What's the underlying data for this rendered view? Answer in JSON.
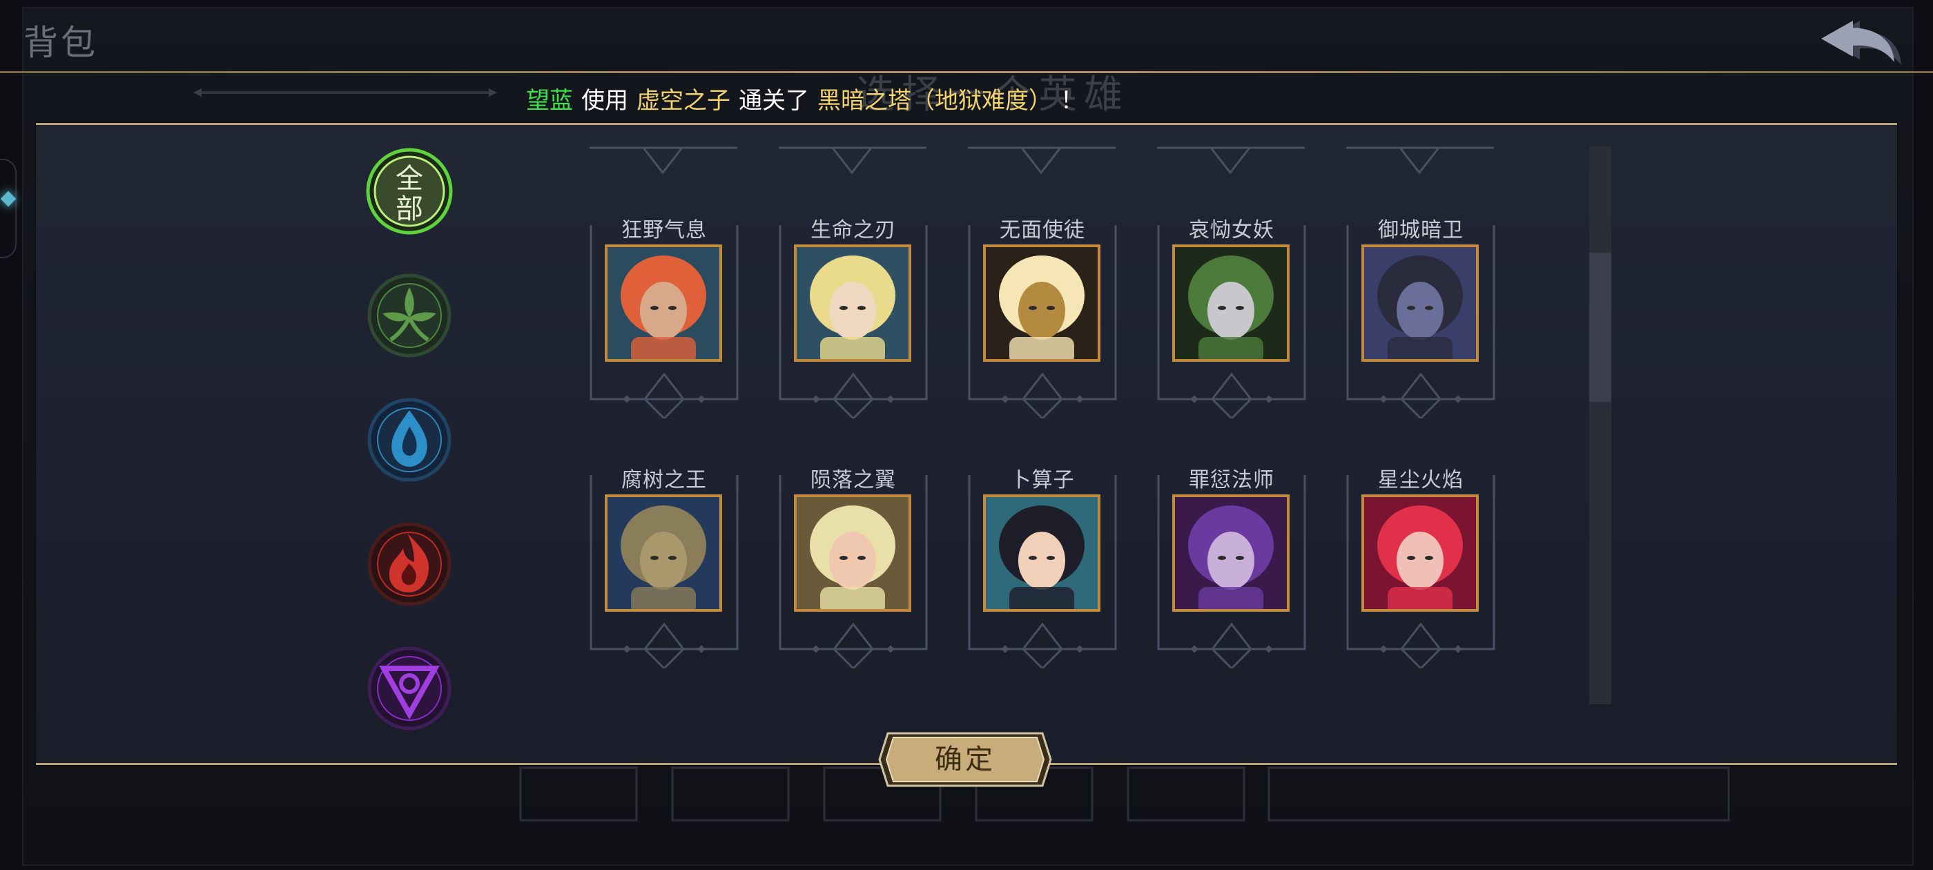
{
  "window": {
    "title": "背包"
  },
  "behind_title": "选择一个英雄",
  "broadcast": {
    "player": "望蓝",
    "verb_use": "使用",
    "hero": "虚空之子",
    "verb_clear": "通关了",
    "stage": "黑暗之塔（地狱难度）",
    "end": "！"
  },
  "filters": [
    {
      "id": "all",
      "label": "全部",
      "icon": "all-faction-icon",
      "selected": true,
      "color": "#5fd33b"
    },
    {
      "id": "nature",
      "label": "",
      "icon": "leaf-faction-icon",
      "selected": false,
      "color": "#4b8a3e"
    },
    {
      "id": "water",
      "label": "",
      "icon": "water-faction-icon",
      "selected": false,
      "color": "#2e86b8"
    },
    {
      "id": "fire",
      "label": "",
      "icon": "fire-faction-icon",
      "selected": false,
      "color": "#c22a23"
    },
    {
      "id": "void",
      "label": "",
      "icon": "void-faction-icon",
      "selected": false,
      "color": "#8b2bc9"
    }
  ],
  "heroes": [
    {
      "name": "狂野气息",
      "portrait": "red-haired-warrior-portrait",
      "bg": "#2b4b5f",
      "hair": "#e0603a",
      "skin": "#d8a88a"
    },
    {
      "name": "生命之刃",
      "portrait": "blonde-elf-portrait",
      "bg": "#2f4f63",
      "hair": "#eadb8c",
      "skin": "#f0d8c0"
    },
    {
      "name": "无面使徒",
      "portrait": "faceless-lantern-portrait",
      "bg": "#2a2118",
      "hair": "#f6e6b6",
      "skin": "#b48a40"
    },
    {
      "name": "哀恸女妖",
      "portrait": "banshee-portrait",
      "bg": "#1d2a1a",
      "hair": "#4c7a3a",
      "skin": "#c8c8cc"
    },
    {
      "name": "御城暗卫",
      "portrait": "dark-guard-portrait",
      "bg": "#3a3f6a",
      "hair": "#2a2c3e",
      "skin": "#6a6f9a"
    },
    {
      "name": "腐树之王",
      "portrait": "tree-king-portrait",
      "bg": "#243a5c",
      "hair": "#8a7d5a",
      "skin": "#a8986c"
    },
    {
      "name": "陨落之翼",
      "portrait": "fallen-wing-portrait",
      "bg": "#6a5a3a",
      "hair": "#e8e0a8",
      "skin": "#f0c8b0"
    },
    {
      "name": "卜算子",
      "portrait": "diviner-portrait",
      "bg": "#2e6a7a",
      "hair": "#1e1e2a",
      "skin": "#f0d0b8"
    },
    {
      "name": "罪愆法师",
      "portrait": "sin-mage-portrait",
      "bg": "#3a1a4a",
      "hair": "#6a3aa0",
      "skin": "#c8b0d8"
    },
    {
      "name": "星尘火焰",
      "portrait": "stardust-flame-portrait",
      "bg": "#7a1430",
      "hair": "#e0304a",
      "skin": "#f0c0b8"
    }
  ],
  "confirm": {
    "label": "确定"
  },
  "colors": {
    "accent_gold": "#b8a27a",
    "portrait_border": "#c28a3c",
    "text_green": "#3ee04b",
    "text_gold": "#f2d36b"
  }
}
